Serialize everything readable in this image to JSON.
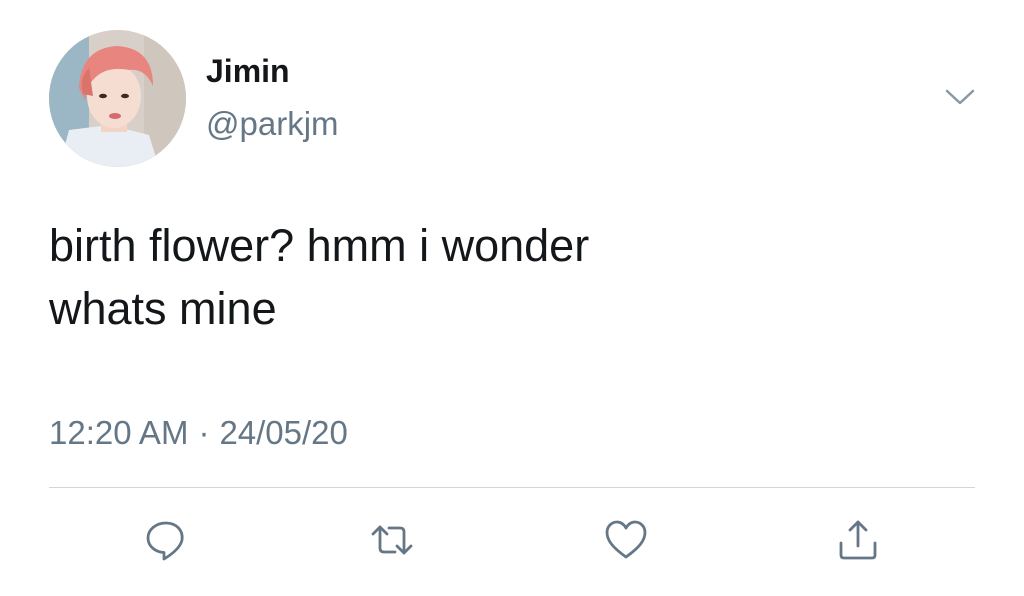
{
  "user": {
    "display_name": "Jimin",
    "handle": "@parkjm"
  },
  "tweet": {
    "text": "birth flower? hmm i wonder\nwhats mine",
    "time": "12:20 AM",
    "separator": "·",
    "date": "24/05/20"
  },
  "actions": {
    "reply_icon": "reply-icon",
    "retweet_icon": "retweet-icon",
    "like_icon": "heart-icon",
    "share_icon": "share-icon"
  },
  "colors": {
    "text": "#14171a",
    "secondary": "#657786",
    "divider": "#ccd6dd",
    "avatar_hair": "#e8857e"
  }
}
